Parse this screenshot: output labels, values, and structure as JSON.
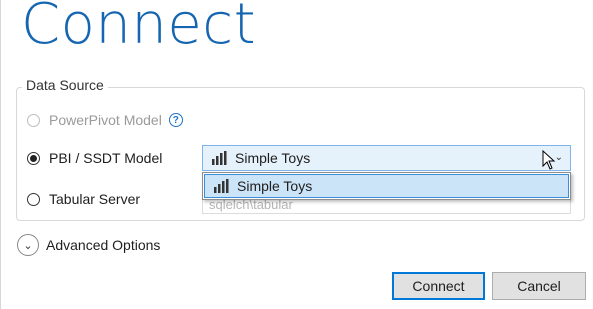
{
  "title": "Connect",
  "data_source": {
    "legend": "Data Source",
    "options": [
      {
        "label": "PowerPivot Model",
        "state": "disabled",
        "selected": false
      },
      {
        "label": "PBI / SSDT Model",
        "state": "enabled",
        "selected": true
      },
      {
        "label": "Tabular Server",
        "state": "enabled",
        "selected": false
      }
    ],
    "help_icon": "?",
    "model_combo": {
      "value": "Simple Toys",
      "icon": "power-bi-icon"
    },
    "model_dropdown": {
      "items": [
        "Simple Toys"
      ],
      "highlighted": "Simple Toys"
    },
    "server_input": {
      "value": "sqlelch\\tabular"
    }
  },
  "advanced": {
    "label": "Advanced Options"
  },
  "buttons": {
    "connect": "Connect",
    "cancel": "Cancel"
  },
  "colors": {
    "title": "#1565b0",
    "selection": "#cce4f7",
    "focus": "#0078d7"
  }
}
